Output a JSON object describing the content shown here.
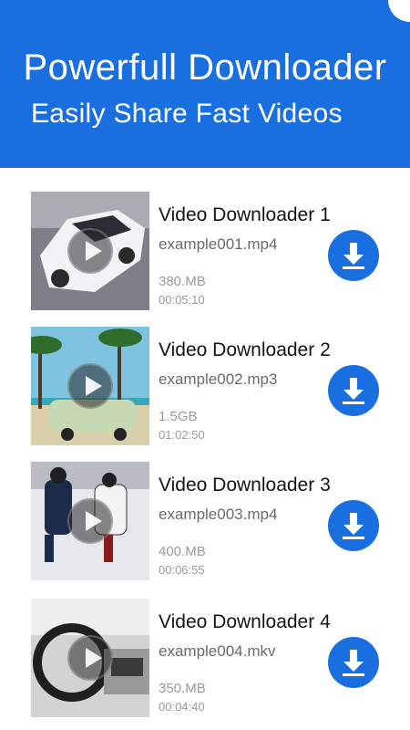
{
  "header": {
    "title": "Powerfull Downloader",
    "subtitle": "Easily Share Fast Videos"
  },
  "colors": {
    "accent": "#1a6fe0"
  },
  "icons": {
    "play": "play-icon",
    "download": "download-icon"
  },
  "videos": [
    {
      "title": "Video Downloader 1",
      "file": "example001.mp4",
      "size": "380.MB",
      "duration": "00:05:10",
      "thumbnail": "car"
    },
    {
      "title": "Video Downloader 2",
      "file": "example002.mp3",
      "size": "1.5GB",
      "duration": "01:02:50",
      "thumbnail": "beach van"
    },
    {
      "title": "Video Downloader 3",
      "file": "example003.mp4",
      "size": "400.MB",
      "duration": "00:06:55",
      "thumbnail": "hockey"
    },
    {
      "title": "Video Downloader 4",
      "file": "example004.mkv",
      "size": "350.MB",
      "duration": "00:04:40",
      "thumbnail": "car interior"
    }
  ]
}
